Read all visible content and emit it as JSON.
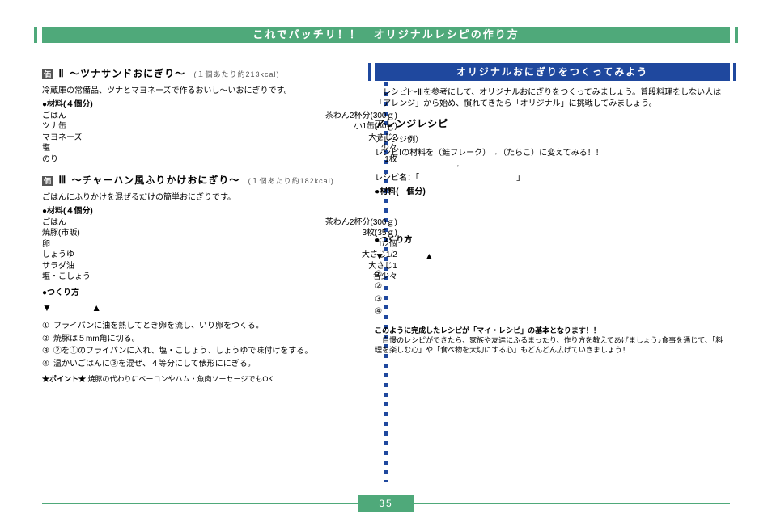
{
  "header": {
    "title": "これでバッチリ！！　オリジナルレシピの作り方"
  },
  "page_number": "35",
  "left": {
    "recipe2": {
      "heading_num": "Ⅱ",
      "heading_name": "～ツナサンドおにぎり～",
      "tag": "価",
      "cal": "(１個あたり約213kcal)",
      "lead": "冷蔵庫の常備品、ツナとマヨネーズで作るおいし～いおにぎりです。",
      "ing_title": "●材料(４個分)",
      "ings": [
        [
          "ごはん",
          "茶わん2杯分(300ｇ)"
        ],
        [
          "ツナ缶",
          "小1缶(80ｇ)"
        ],
        [
          "マヨネーズ",
          "大さじ2"
        ],
        [
          "塩",
          "少々"
        ],
        [
          "のり",
          "1枚"
        ]
      ]
    },
    "recipe3": {
      "heading_num": "Ⅲ",
      "heading_name": "～チャーハン風ふりかけおにぎり～",
      "tag": "価",
      "cal": "(１個あたり約182kcal)",
      "lead": "ごはんにふりかけを混ぜるだけの簡単おにぎりです。",
      "ing_title": "●材料(４個分)",
      "ings": [
        [
          "ごはん",
          "茶わん2杯分(300ｇ)"
        ],
        [
          "焼豚(市販)",
          "3枚(35ｇ)"
        ],
        [
          "卵",
          "1/2個"
        ],
        [
          "しょうゆ",
          "大さじ1/2"
        ],
        [
          "サラダ油",
          "大さじ1"
        ],
        [
          "塩・こしょう",
          "各少々"
        ]
      ],
      "steps_title": "●つくり方",
      "down_up": {
        "down": "▼",
        "up": "▲"
      },
      "steps": [
        [
          "①",
          "フライパンに油を熱してとき卵を流し、いり卵をつくる。"
        ],
        [
          "②",
          "焼豚は５mm角に切る。"
        ],
        [
          "③",
          "②を①のフライパンに入れ、塩・こしょう、しょうゆで味付けをする。"
        ],
        [
          "④",
          "温かいごはんに③を混ぜ、４等分にして俵形ににぎる。"
        ]
      ],
      "point_label": "★ポイント★",
      "point_text": "焼豚の代わりにベーコンやハム・魚肉ソーセージでもOK"
    }
  },
  "right": {
    "barTitle": "オリジナルおにぎりをつくってみよう",
    "intro": "　レシピⅠ～Ⅲを参考にして、オリジナルおにぎりをつくってみましょう。普段料理をしない人は「アレンジ」から始め、慣れてきたら「オリジナル」に挑戦してみましょう。",
    "arrange_title": "アレンジレシピ",
    "arrange_example_label": "アレンジ例）",
    "arrange_example": "レシピⅠの材料を（鮭フレーク）→（たらこ）に変えてみる！！",
    "arrow": "→",
    "recipe_name_row": "レシピ名：「　　　　　　　　　　　　」",
    "ing_title": "●材料(　個分)",
    "ing_rows": 6,
    "steps_title": "●つくり方",
    "down_up": {
      "down": "▼",
      "up": "▲"
    },
    "step_nums": [
      "①",
      "②",
      "③",
      "④"
    ],
    "box_title": "このように完成したレシピが「マイ・レシピ」の基本となります！！",
    "box_body": "　自慢のレシピができたら、家族や友達にふるまったり、作り方を教えてあげましょう♪食事を通じて、「料理を楽しむ心」や「食べ物を大切にする心」もどんどん広げていきましょう！"
  }
}
